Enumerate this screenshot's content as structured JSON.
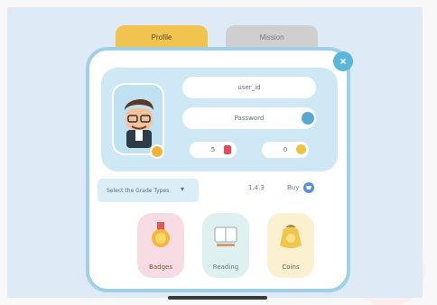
{
  "tabs": {
    "profile_label": "Profile",
    "mission_label": "Mission"
  },
  "close_label": "×",
  "profile": {
    "username": "user_id",
    "password": "Password",
    "gem_count": "5",
    "coin_count": "0"
  },
  "controls": {
    "select_label": "Select the Grade Types",
    "version": "1.4.3",
    "buy_label": "Buy"
  },
  "tiles": [
    {
      "label": "Badges",
      "icon": "medal-icon"
    },
    {
      "label": "Reading",
      "icon": "book-icon"
    },
    {
      "label": "Coins",
      "icon": "coin-bag-icon"
    }
  ],
  "colors": {
    "accent_yellow": "#f1c34f",
    "accent_blue": "#5bb6db",
    "card_border": "#9fd0e8"
  }
}
